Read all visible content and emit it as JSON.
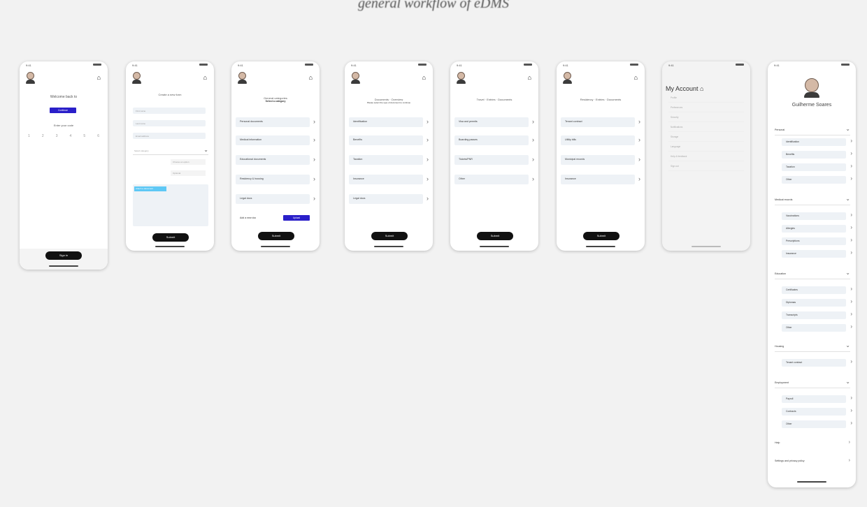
{
  "caption": "general workflow of eDMS",
  "status": {
    "time": "9:41",
    "battery": "▮▮▮"
  },
  "screen1": {
    "title": "Welcome back to",
    "primary_btn": "Continue",
    "code_label": "Enter your code",
    "code_digits": [
      "1",
      "2",
      "3",
      "4",
      "5",
      "6"
    ],
    "pill": "Sign in"
  },
  "screen2": {
    "title": "Create a new form",
    "fields": [
      "First name",
      "Last name",
      "Email address"
    ],
    "select": "Select category",
    "opt1": "Choose an option",
    "opt2": "Optional",
    "chip": "Attach a document",
    "pill": "Submit"
  },
  "screen3": {
    "title": "General categories",
    "subtitle": "Select a category",
    "rows": [
      "Personal documents",
      "Medical information",
      "Educational documents",
      "Residency & housing",
      "Legal docs"
    ],
    "footer_label": "Add a new doc",
    "footer_btn": "Upload",
    "pill": "Submit"
  },
  "screen4": {
    "title": "Documents · Overview",
    "subtitle": "Please select the type of document to continue",
    "rows": [
      "Identification",
      "Benefits",
      "Taxation",
      "Insurance",
      "Legal docs"
    ],
    "pill": "Submit"
  },
  "screen5": {
    "title": "Travel · Entries · Documents",
    "rows": [
      "Visa and permits",
      "Boarding passes",
      "Tickets/PNR",
      "Other"
    ],
    "pill": "Submit"
  },
  "screen6": {
    "title": "Residency · Entries · Documents",
    "rows": [
      "Tenant contract",
      "Utility bills",
      "Municipal records",
      "Insurance"
    ],
    "pill": "Submit"
  },
  "screen7": {
    "title": "My Account",
    "items": [
      "Profile",
      "Preferences",
      "Security",
      "Notifications",
      "Storage",
      "Language",
      "Help & feedback",
      "Sign out"
    ]
  },
  "screen8": {
    "name": "Guilherme Soares",
    "sections": [
      {
        "label": "Personal",
        "items": [
          "Identification",
          "Benefits",
          "Taxation",
          "Other"
        ]
      },
      {
        "label": "Medical records",
        "items": [
          "Vaccinations",
          "Allergies",
          "Prescriptions",
          "Insurance"
        ]
      },
      {
        "label": "Education",
        "items": [
          "Certificates",
          "Diplomas",
          "Transcripts",
          "Other"
        ]
      },
      {
        "label": "Housing",
        "items": [
          "Tenant contract"
        ]
      },
      {
        "label": "Employment",
        "items": [
          "Payroll",
          "Contracts",
          "Other"
        ]
      }
    ],
    "extra1": "Help",
    "extra2": "Settings and privacy policy"
  },
  "colors": {
    "accent": "#2a1fc9",
    "chip": "#5ec8f5",
    "pill": "#111111"
  }
}
